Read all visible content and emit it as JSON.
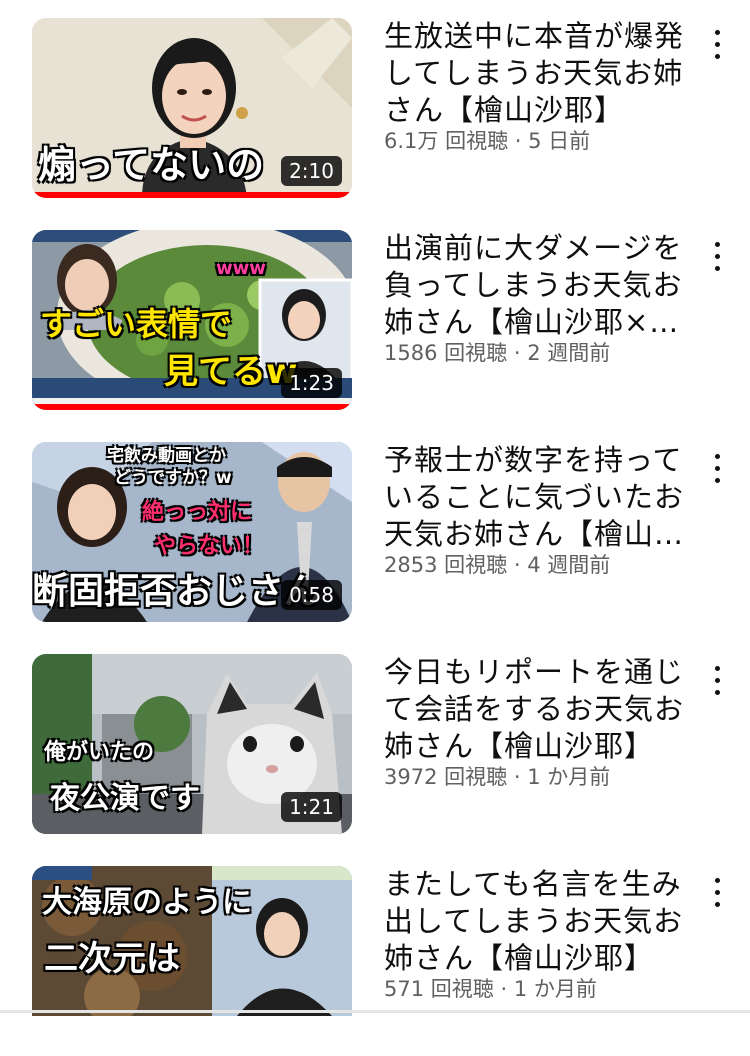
{
  "videos": [
    {
      "title_lines": [
        "生放送中に本音が爆発",
        "してしまうお天気お姉",
        "さん【檜山沙耶】"
      ],
      "views": "6.1万 回視聴",
      "separator": "·",
      "age": "5 日前",
      "duration": "2:10",
      "watched_progress": 1.0,
      "thumb_caption": [
        "煽ってないの"
      ]
    },
    {
      "title_lines": [
        "出演前に大ダメージを",
        "負ってしまうお天気お",
        "姉さん【檜山沙耶×…"
      ],
      "views": "1586 回視聴",
      "separator": "·",
      "age": "2 週間前",
      "duration": "1:23",
      "watched_progress": 1.0,
      "thumb_caption": [
        "www",
        "すごい表情で",
        "見てるw"
      ]
    },
    {
      "title_lines": [
        "予報士が数字を持って",
        "いることに気づいたお",
        "天気お姉さん【檜山…"
      ],
      "views": "2853 回視聴",
      "separator": "·",
      "age": "4 週間前",
      "duration": "0:58",
      "watched_progress": 0,
      "thumb_caption": [
        "宅飲み動画とか",
        "どうですか？w",
        "絶っっ対に",
        "やらない！",
        "断固拒否おじさん"
      ]
    },
    {
      "title_lines": [
        "今日もリポートを通じ",
        "て会話をするお天気お",
        "姉さん【檜山沙耶】"
      ],
      "views": "3972 回視聴",
      "separator": "·",
      "age": "1 か月前",
      "duration": "1:21",
      "watched_progress": 0,
      "thumb_caption": [
        "俺がいたの",
        "夜公演です"
      ]
    },
    {
      "title_lines": [
        "またしても名言を生み",
        "出してしまうお天気お",
        "姉さん【檜山沙耶】"
      ],
      "views": "571 回視聴",
      "separator": "·",
      "age": "1 か月前",
      "duration": "",
      "watched_progress": 0,
      "thumb_caption": [
        "大海原のように",
        "二次元は"
      ]
    }
  ],
  "colors": {
    "progress": "#ff0000",
    "meta_text": "#606060",
    "title_text": "#0f0f0f"
  },
  "icons": {
    "more": "vertical-ellipsis-icon"
  }
}
